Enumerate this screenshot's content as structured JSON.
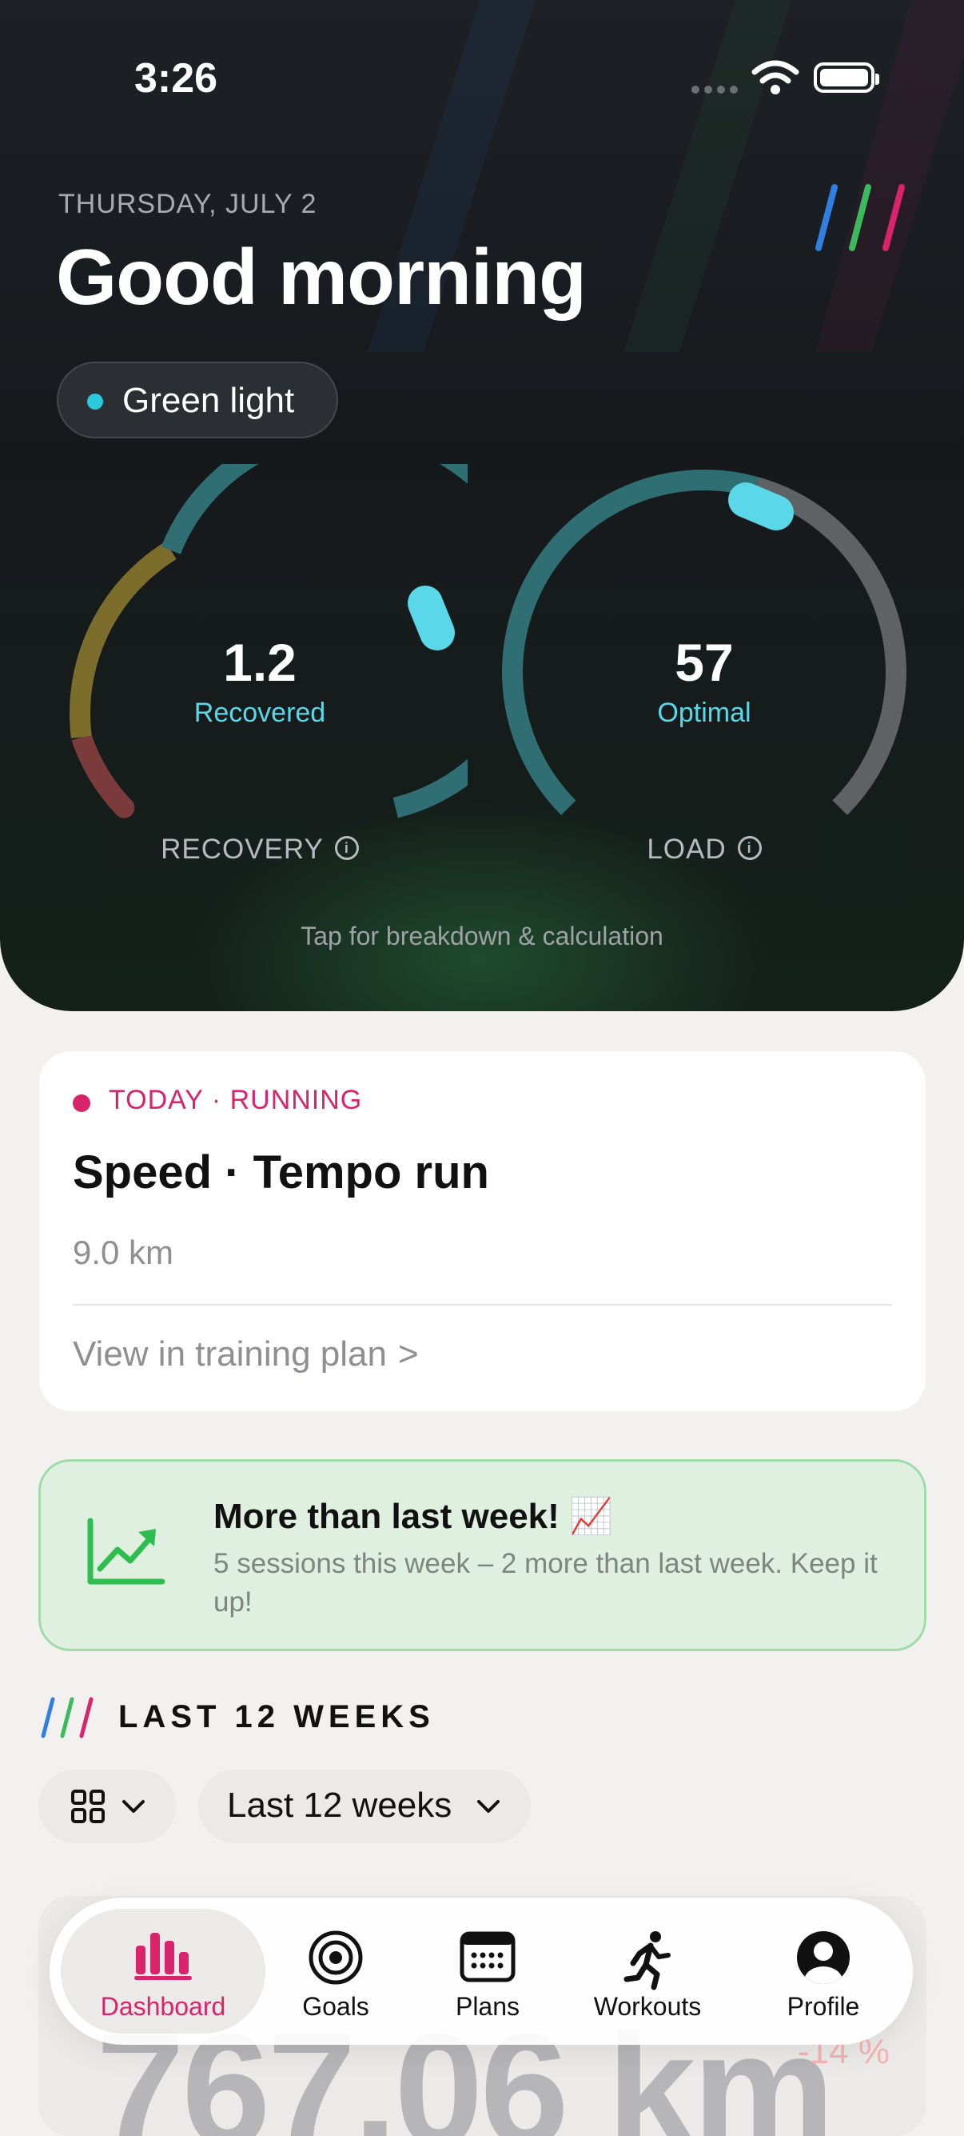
{
  "status": {
    "time": "3:26"
  },
  "header": {
    "date": "THURSDAY, JULY 2",
    "greeting": "Good morning",
    "status_pill": "Green light"
  },
  "gauges": [
    {
      "value": "1.2",
      "state": "Recovered",
      "label": "RECOVERY",
      "level": 0.72
    },
    {
      "value": "57",
      "state": "Optimal",
      "label": "LOAD",
      "level": 0.57
    }
  ],
  "tap_hint": "Tap for breakdown & calculation",
  "today_card": {
    "tag": "TODAY · RUNNING",
    "title": "Speed · Tempo run",
    "distance": "9.0 km",
    "link": "View in training plan",
    "link_chevron": ">"
  },
  "banner": {
    "title": "More than last week! 📈",
    "body": "5 sessions this week – 2 more than last week. Keep it up!"
  },
  "section": {
    "title": "LAST 12 WEEKS",
    "range_selector": "Last 12 weeks"
  },
  "stat_behind": {
    "value": "767.06 km",
    "delta": "-14 %"
  },
  "tabbar": {
    "items": [
      {
        "label": "Dashboard",
        "icon": "bar-chart-icon",
        "active": true
      },
      {
        "label": "Goals",
        "icon": "target-icon",
        "active": false
      },
      {
        "label": "Plans",
        "icon": "calendar-icon",
        "active": false
      },
      {
        "label": "Workouts",
        "icon": "runner-icon",
        "active": false
      },
      {
        "label": "Profile",
        "icon": "profile-icon",
        "active": false
      }
    ]
  },
  "colors": {
    "accent_pink": "#d9236b",
    "accent_cyan": "#5ad8ea",
    "stripe_blue": "#2f7fe0",
    "stripe_green": "#3cb95a",
    "banner_green": "#2ebd4e"
  }
}
